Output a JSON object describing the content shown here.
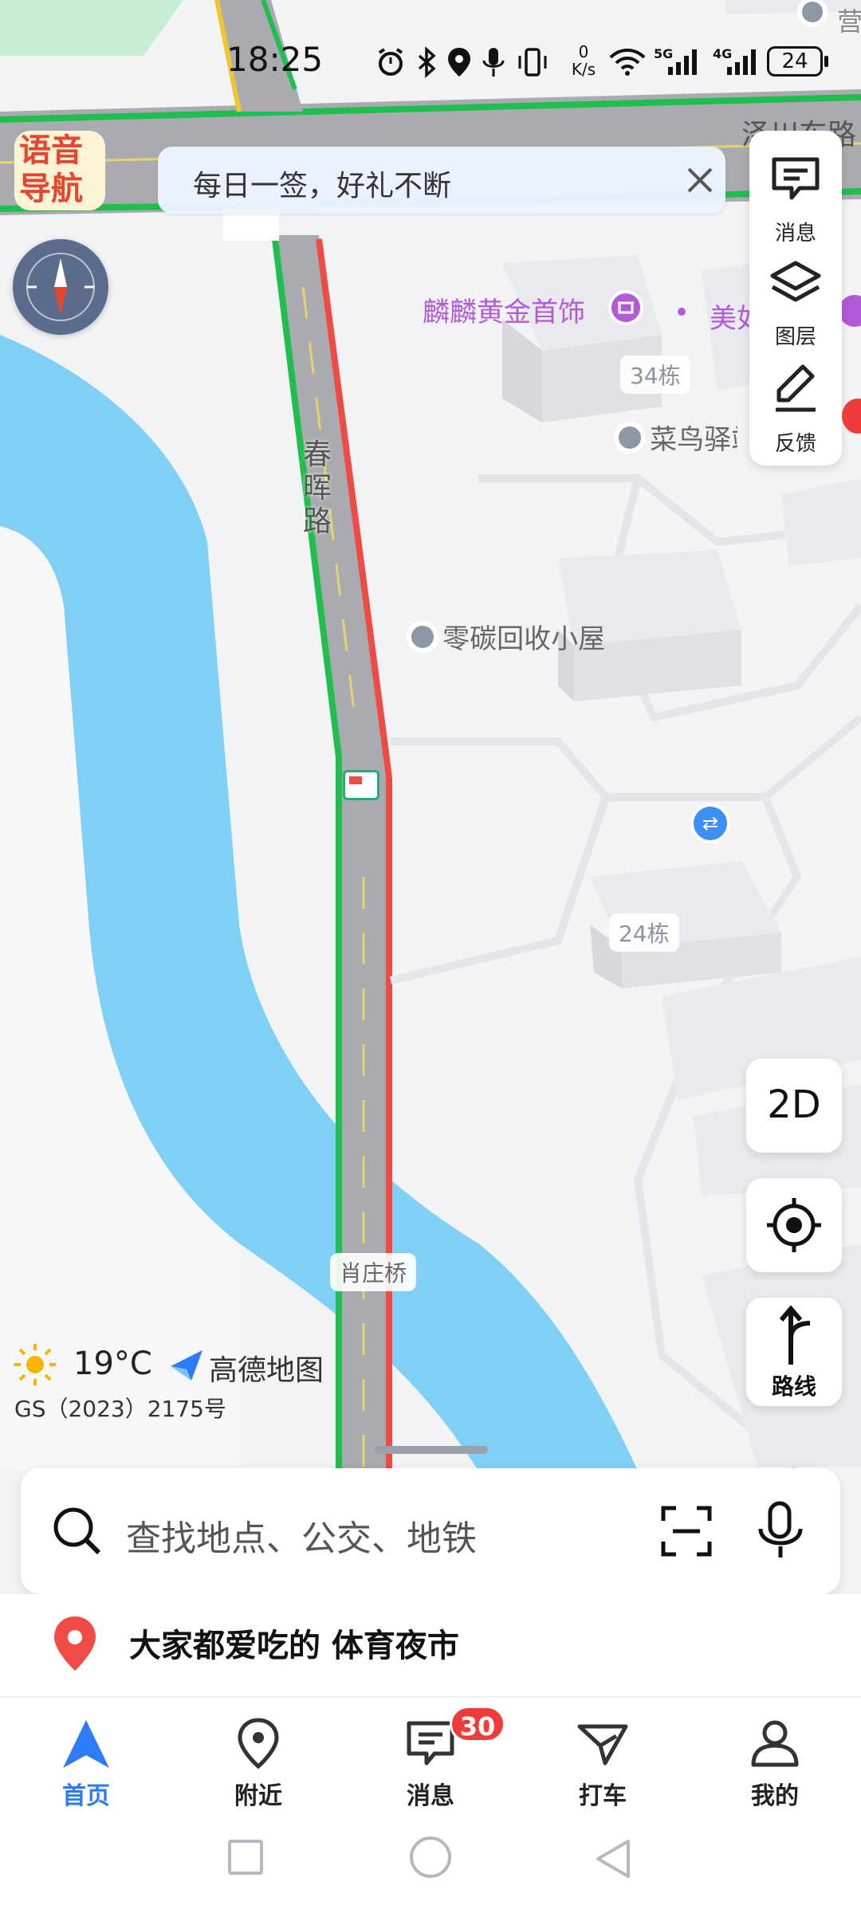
{
  "status_bar": {
    "time": "18:25",
    "net_speed_top": "0",
    "net_speed_unit": "K/s",
    "sig1": "5G",
    "sig2": "4G",
    "battery": "24"
  },
  "map": {
    "voice_nav_line1": "语音",
    "voice_nav_line2": "导航",
    "banner_text": "每日一签，好礼不断",
    "road_name": "春晖路",
    "bridge_name": "肖庄桥",
    "poi": {
      "jewelry": "麟麟黄金首饰",
      "mei": "美如",
      "building34": "34栋",
      "cainiao": "菜鸟驿站",
      "recycle": "零碳回收小屋",
      "building24": "24栋",
      "road_top_right": "泽川东路",
      "top_right_edge": "营"
    },
    "weather_temp": "19°C",
    "logo_text": "高德地图",
    "gs_number": "GS（2023）2175号"
  },
  "side_panel": {
    "messages_label": "消息",
    "layers_label": "图层",
    "feedback_label": "反馈"
  },
  "buttons": {
    "mode_2d": "2D",
    "route_label": "路线"
  },
  "search": {
    "placeholder": "查找地点、公交、地铁"
  },
  "suggestion": {
    "text": "大家都爱吃的 体育夜市"
  },
  "tabs": [
    {
      "label": "首页",
      "active": true
    },
    {
      "label": "附近",
      "active": false
    },
    {
      "label": "消息",
      "active": false,
      "badge": "30"
    },
    {
      "label": "打车",
      "active": false
    },
    {
      "label": "我的",
      "active": false
    }
  ],
  "colors": {
    "accent": "#2d7bf6",
    "water": "#7fd0f4",
    "road": "#a9abb0",
    "route_green": "#1fbe4f",
    "route_red": "#ee4b44",
    "badge": "#f03b3b",
    "poi_purple": "#b35ad6"
  }
}
